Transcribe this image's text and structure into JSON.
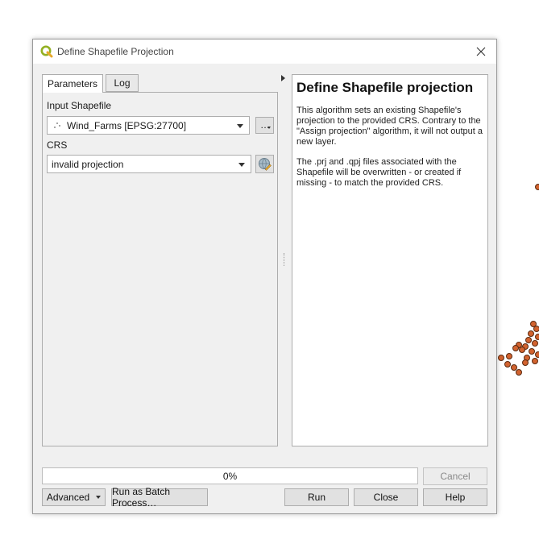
{
  "window": {
    "title": "Define Shapefile Projection",
    "close_icon": "close-icon",
    "app_icon": "qgis-logo-icon"
  },
  "tabs": [
    {
      "label": "Parameters",
      "active": true
    },
    {
      "label": "Log",
      "active": false
    }
  ],
  "params": {
    "input_label": "Input Shapefile",
    "input_value": "Wind_Farms [EPSG:27700]",
    "input_icon": "point-layer-icon",
    "browse_label": "…",
    "crs_label": "CRS",
    "crs_value": "invalid projection",
    "crs_select_icon": "globe-select-icon"
  },
  "help": {
    "title": "Define Shapefile projection",
    "para1": "This algorithm sets an existing Shapefile's projection to the provided CRS. Contrary to the \"Assign projection\" algorithm, it will not output a new layer.",
    "para2": "The .prj and .qpj files associated with the Shapefile will be overwritten - or created if missing - to match the provided CRS."
  },
  "progress": {
    "value": 0,
    "text": "0%"
  },
  "buttons": {
    "cancel": "Cancel",
    "advanced": "Advanced",
    "batch": "Run as Batch Process…",
    "run": "Run",
    "close": "Close",
    "help": "Help"
  },
  "colors": {
    "point_fill": "#d2632f",
    "point_stroke": "#5a2a10",
    "progress": "#06b025"
  }
}
